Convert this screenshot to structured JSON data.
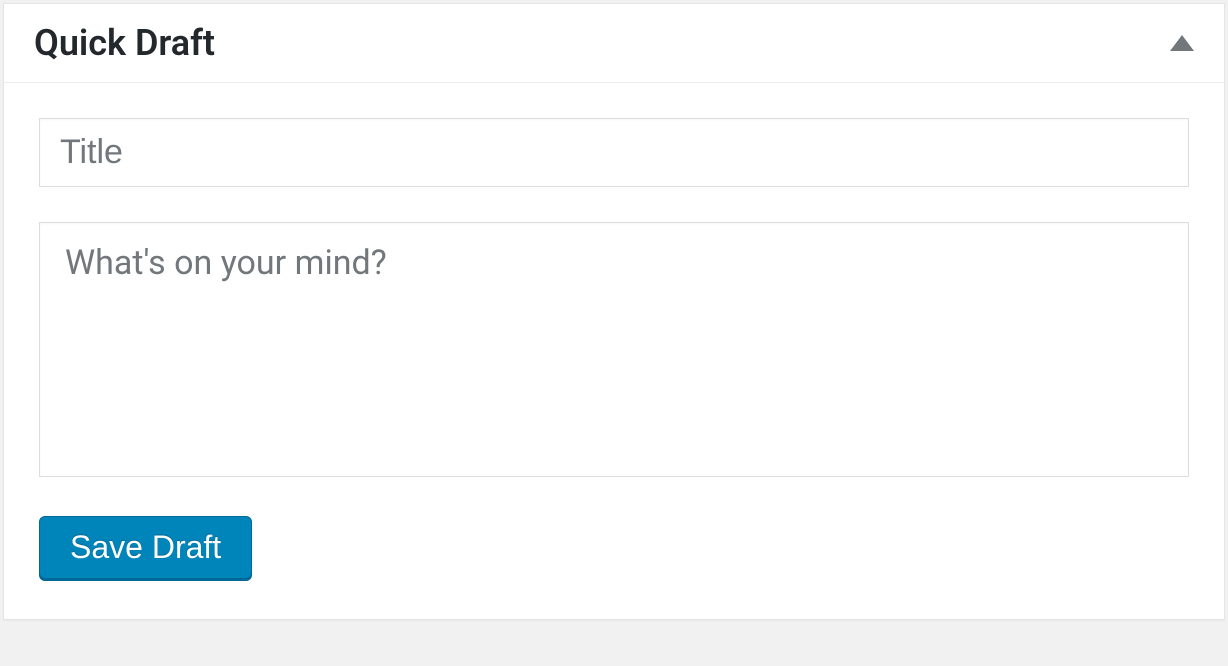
{
  "widget": {
    "title": "Quick Draft",
    "title_placeholder": "Title",
    "content_placeholder": "What's on your mind?",
    "save_button_label": "Save Draft"
  }
}
